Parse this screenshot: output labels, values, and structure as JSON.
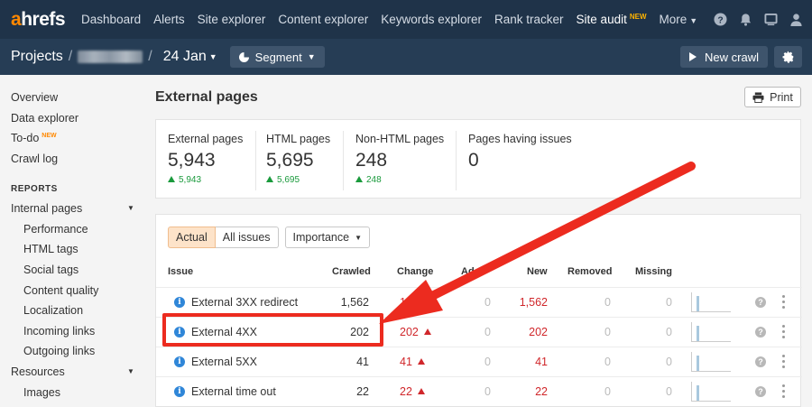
{
  "topnav": {
    "logo_a": "a",
    "logo_rest": "hrefs",
    "items": [
      {
        "label": "Dashboard"
      },
      {
        "label": "Alerts"
      },
      {
        "label": "Site explorer"
      },
      {
        "label": "Content explorer"
      },
      {
        "label": "Keywords explorer"
      },
      {
        "label": "Rank tracker"
      },
      {
        "label": "Site audit",
        "badge": "NEW",
        "active": true
      },
      {
        "label": "More"
      }
    ],
    "icons": [
      "help-icon",
      "bell-icon",
      "screen-icon",
      "user-icon"
    ]
  },
  "projectbar": {
    "projects_label": "Projects",
    "separator": "/",
    "date_label": "24 Jan",
    "segment_label": "Segment",
    "new_crawl_label": "New crawl",
    "settings_icon": "gear-icon"
  },
  "sidebar": {
    "top_items": [
      {
        "label": "Overview"
      },
      {
        "label": "Data explorer"
      },
      {
        "label": "To-do",
        "badge": "NEW"
      },
      {
        "label": "Crawl log"
      }
    ],
    "reports_header": "REPORTS",
    "internal_pages": "Internal pages",
    "internal_sub": [
      "Performance",
      "HTML tags",
      "Social tags",
      "Content quality",
      "Localization",
      "Incoming links",
      "Outgoing links"
    ],
    "resources": "Resources",
    "resources_sub": [
      "Images"
    ]
  },
  "main": {
    "title": "External pages",
    "print_label": "Print",
    "stats": [
      {
        "label": "External pages",
        "value": "5,943",
        "delta": "5,943"
      },
      {
        "label": "HTML pages",
        "value": "5,695",
        "delta": "5,695"
      },
      {
        "label": "Non-HTML pages",
        "value": "248",
        "delta": "248"
      },
      {
        "label": "Pages having issues",
        "value": "0",
        "delta": ""
      }
    ],
    "filters": {
      "actual": "Actual",
      "all_issues": "All issues",
      "importance": "Importance"
    },
    "columns": {
      "issue": "Issue",
      "crawled": "Crawled",
      "change": "Change",
      "added": "Ad",
      "new": "New",
      "removed": "Removed",
      "missing": "Missing"
    },
    "rows": [
      {
        "issue": "External 3XX redirect",
        "crawled": "1,562",
        "change": "1,5",
        "added": "0",
        "new": "1,562",
        "removed": "0",
        "missing": "0",
        "spark": 0.75
      },
      {
        "issue": "External 4XX",
        "crawled": "202",
        "change": "202",
        "added": "0",
        "new": "202",
        "removed": "0",
        "missing": "0",
        "spark": 0.75
      },
      {
        "issue": "External 5XX",
        "crawled": "41",
        "change": "41",
        "added": "0",
        "new": "41",
        "removed": "0",
        "missing": "0",
        "spark": 0.75
      },
      {
        "issue": "External time out",
        "crawled": "22",
        "change": "22",
        "added": "0",
        "new": "22",
        "removed": "0",
        "missing": "0",
        "spark": 0.75
      }
    ]
  },
  "colors": {
    "nav_bg": "#1f3349",
    "project_bg": "#263d55",
    "accent": "#ff8800",
    "annotation_red": "#ec2b1f",
    "positive": "#1a9a3c",
    "negative": "#d0272b"
  }
}
